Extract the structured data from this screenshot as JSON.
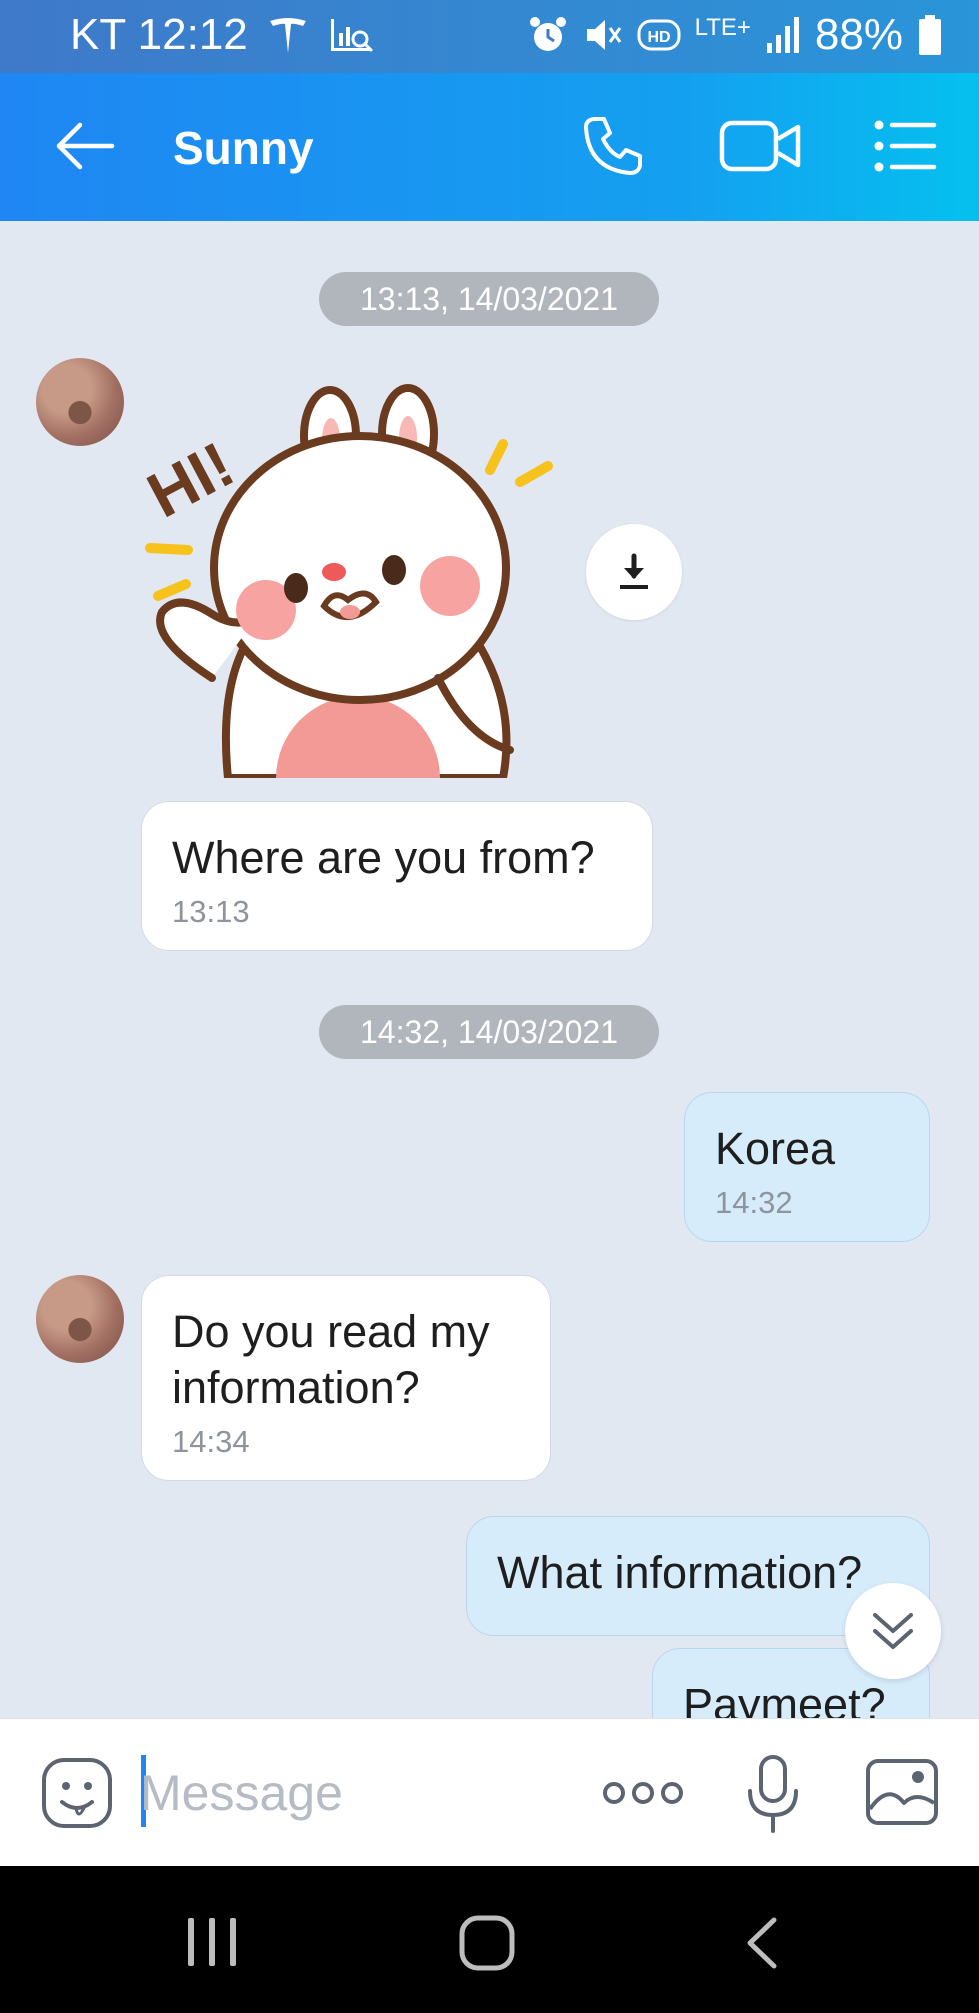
{
  "status_bar": {
    "carrier_time": "KT 12:12",
    "hd_label": "HD",
    "network": "LTE+",
    "battery": "88%"
  },
  "header": {
    "contact_name": "Sunny",
    "icons": [
      "back-arrow-icon",
      "phone-icon",
      "video-camera-icon",
      "menu-list-icon"
    ]
  },
  "conversation": {
    "date_separators": [
      "13:13, 14/03/2021",
      "14:32, 14/03/2021"
    ],
    "sticker": {
      "text": "HI!",
      "description": "white bunny waving"
    },
    "messages": [
      {
        "direction": "incoming",
        "text": "Where are you from?",
        "time": "13:13"
      },
      {
        "direction": "outgoing",
        "text": "Korea",
        "time": "14:32"
      },
      {
        "direction": "incoming",
        "text": "Do you read my information?",
        "time": "14:34"
      },
      {
        "direction": "outgoing",
        "text": "What information?",
        "time": ""
      },
      {
        "direction": "outgoing",
        "text": "Paymeet?",
        "time": ""
      }
    ]
  },
  "composer": {
    "placeholder": "Message",
    "value": "",
    "icons": [
      "emoji-icon",
      "more-options-icon",
      "microphone-icon",
      "gallery-icon"
    ]
  },
  "colors": {
    "header_start": "#1f86f3",
    "header_end": "#05c0ef",
    "chat_background": "#e2e8f1",
    "outgoing_bubble": "#d6ecfb",
    "incoming_bubble": "#ffffff",
    "time_pill": "#b1b6bd"
  }
}
